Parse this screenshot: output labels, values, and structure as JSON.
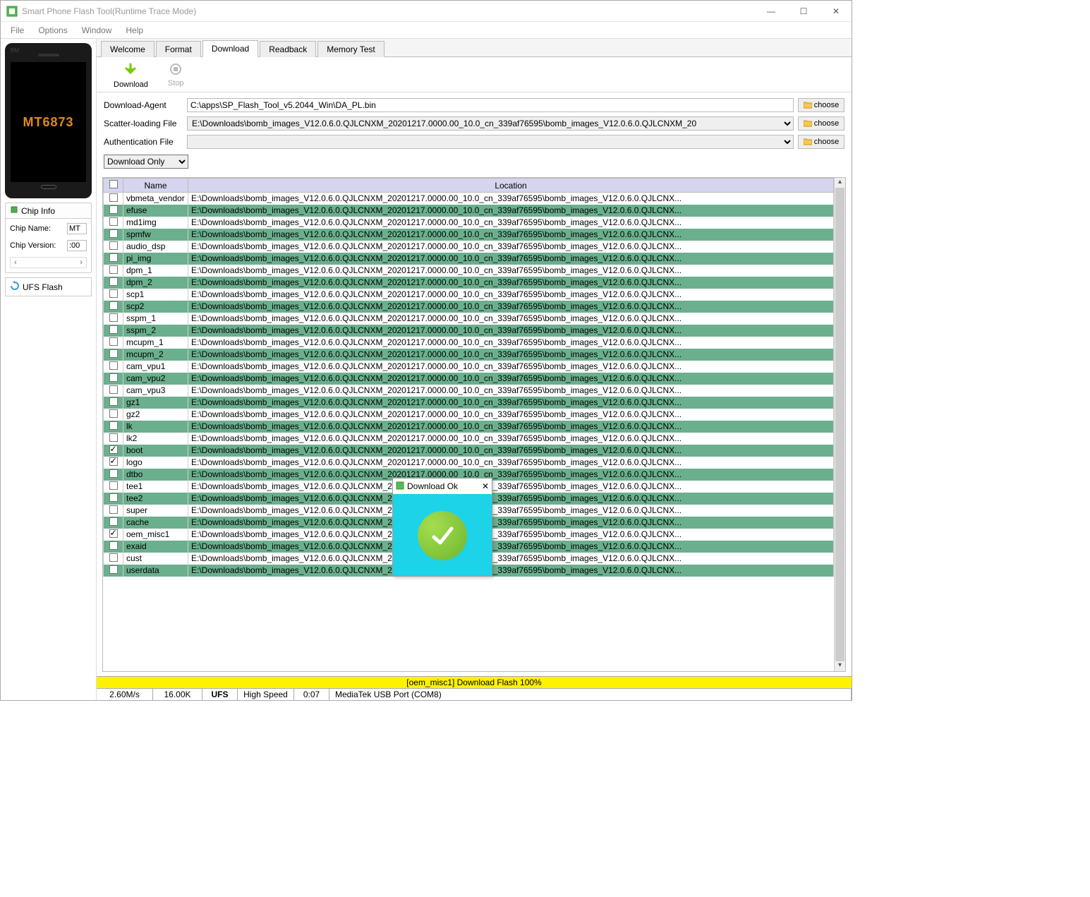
{
  "window": {
    "title": "Smart Phone Flash Tool(Runtime Trace Mode)"
  },
  "menu": {
    "file": "File",
    "options": "Options",
    "window": "Window",
    "help": "Help"
  },
  "phone": {
    "chip": "MT6873",
    "maker": "BM"
  },
  "chip_panel": {
    "header": "Chip Info",
    "name_label": "Chip Name:",
    "name_value": "MT",
    "version_label": "Chip Version:",
    "version_value": ":00"
  },
  "ufs": {
    "label": "UFS Flash"
  },
  "tabs": {
    "welcome": "Welcome",
    "format": "Format",
    "download": "Download",
    "readback": "Readback",
    "memtest": "Memory Test"
  },
  "toolbar": {
    "download": "Download",
    "stop": "Stop"
  },
  "form": {
    "da_label": "Download-Agent",
    "da_value": "C:\\apps\\SP_Flash_Tool_v5.2044_Win\\DA_PL.bin",
    "scatter_label": "Scatter-loading File",
    "scatter_value": "E:\\Downloads\\bomb_images_V12.0.6.0.QJLCNXM_20201217.0000.00_10.0_cn_339af76595\\bomb_images_V12.0.6.0.QJLCNXM_20",
    "auth_label": "Authentication File",
    "auth_value": "",
    "choose": "choose",
    "mode": "Download Only"
  },
  "table": {
    "header_name": "Name",
    "header_location": "Location",
    "loc": "E:\\Downloads\\bomb_images_V12.0.6.0.QJLCNXM_20201217.0000.00_10.0_cn_339af76595\\bomb_images_V12.0.6.0.QJLCNX...",
    "loc_cut": "E:\\Downloads\\bomb_images",
    "loc_tail": "217.0000.00_10.0_cn_339af76595\\bomb_images_V12.0.6.0.QJLCNX...",
    "loc_mid": "E:\\Downloads\\bomb_images_V12.0.6.0.QJLCNXM_20201217.0000.00_10.0_cn_339af76595\\bomb_images_V12.0.6.0.QJLCNX...",
    "rows": [
      {
        "n": "vbmeta_vendor",
        "hl": false,
        "c": false
      },
      {
        "n": "efuse",
        "hl": true,
        "c": false
      },
      {
        "n": "md1img",
        "hl": false,
        "c": false
      },
      {
        "n": "spmfw",
        "hl": true,
        "c": false
      },
      {
        "n": "audio_dsp",
        "hl": false,
        "c": false
      },
      {
        "n": "pi_img",
        "hl": true,
        "c": false
      },
      {
        "n": "dpm_1",
        "hl": false,
        "c": false
      },
      {
        "n": "dpm_2",
        "hl": true,
        "c": false
      },
      {
        "n": "scp1",
        "hl": false,
        "c": false
      },
      {
        "n": "scp2",
        "hl": true,
        "c": false
      },
      {
        "n": "sspm_1",
        "hl": false,
        "c": false
      },
      {
        "n": "sspm_2",
        "hl": true,
        "c": false
      },
      {
        "n": "mcupm_1",
        "hl": false,
        "c": false
      },
      {
        "n": "mcupm_2",
        "hl": true,
        "c": false
      },
      {
        "n": "cam_vpu1",
        "hl": false,
        "c": false
      },
      {
        "n": "cam_vpu2",
        "hl": true,
        "c": false
      },
      {
        "n": "cam_vpu3",
        "hl": false,
        "c": false
      },
      {
        "n": "gz1",
        "hl": true,
        "c": false
      },
      {
        "n": "gz2",
        "hl": false,
        "c": false
      },
      {
        "n": "lk",
        "hl": true,
        "c": false
      },
      {
        "n": "lk2",
        "hl": false,
        "c": false
      },
      {
        "n": "boot",
        "hl": true,
        "c": true
      },
      {
        "n": "logo",
        "hl": false,
        "c": true
      },
      {
        "n": "dtbo",
        "hl": true,
        "c": false
      },
      {
        "n": "tee1",
        "hl": false,
        "c": false
      },
      {
        "n": "tee2",
        "hl": true,
        "c": false
      },
      {
        "n": "super",
        "hl": false,
        "c": false
      },
      {
        "n": "cache",
        "hl": true,
        "c": false
      },
      {
        "n": "oem_misc1",
        "hl": false,
        "c": true
      },
      {
        "n": "exaid",
        "hl": true,
        "c": false
      },
      {
        "n": "cust",
        "hl": false,
        "c": false
      },
      {
        "n": "userdata",
        "hl": true,
        "c": false
      }
    ]
  },
  "dialog": {
    "title": "Download Ok"
  },
  "status": {
    "progress": "[oem_misc1] Download Flash 100%",
    "speed": "2.60M/s",
    "size": "16.00K",
    "storage": "UFS",
    "mode": "High Speed",
    "time": "0:07",
    "port": "MediaTek USB Port (COM8)"
  }
}
